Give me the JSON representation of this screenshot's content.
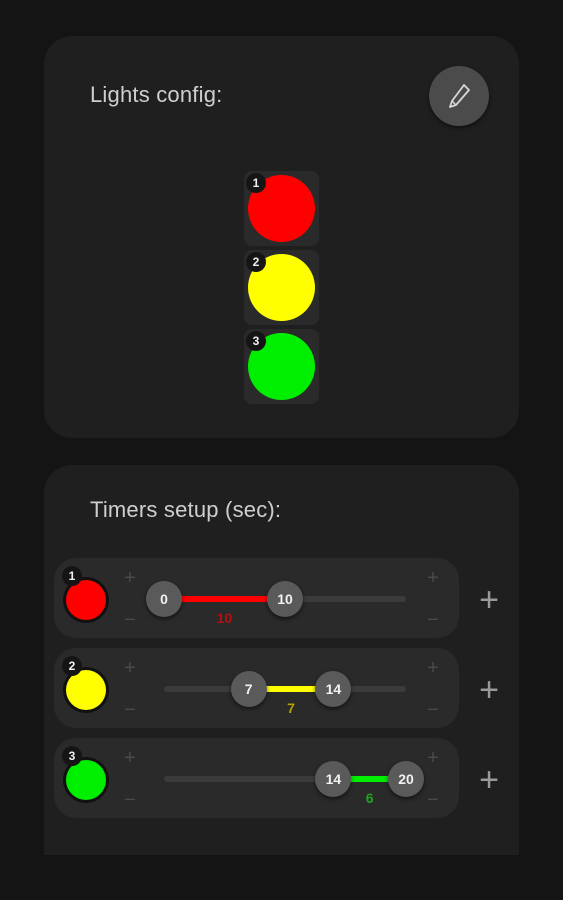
{
  "lights_config": {
    "title": "Lights config:",
    "edit_icon": "pencil-icon",
    "lights": [
      {
        "number": "1",
        "color": "#ff0000"
      },
      {
        "number": "2",
        "color": "#ffff00"
      },
      {
        "number": "3",
        "color": "#00ee00"
      }
    ]
  },
  "timers_setup": {
    "title": "Timers setup (sec):",
    "plus_symbol": "+",
    "minus_symbol": "−",
    "add_symbol": "+",
    "rows": [
      {
        "number": "1",
        "color": "#ff0000",
        "label_color": "#b31010",
        "start": "0",
        "end": "10",
        "duration": "10",
        "start_value": 0,
        "end_value": 10
      },
      {
        "number": "2",
        "color": "#ffff00",
        "label_color": "#b3a400",
        "start": "7",
        "end": "14",
        "duration": "7",
        "start_value": 7,
        "end_value": 14
      },
      {
        "number": "3",
        "color": "#00ee00",
        "label_color": "#1fa51f",
        "start": "14",
        "end": "20",
        "duration": "6",
        "start_value": 14,
        "end_value": 20
      }
    ]
  }
}
